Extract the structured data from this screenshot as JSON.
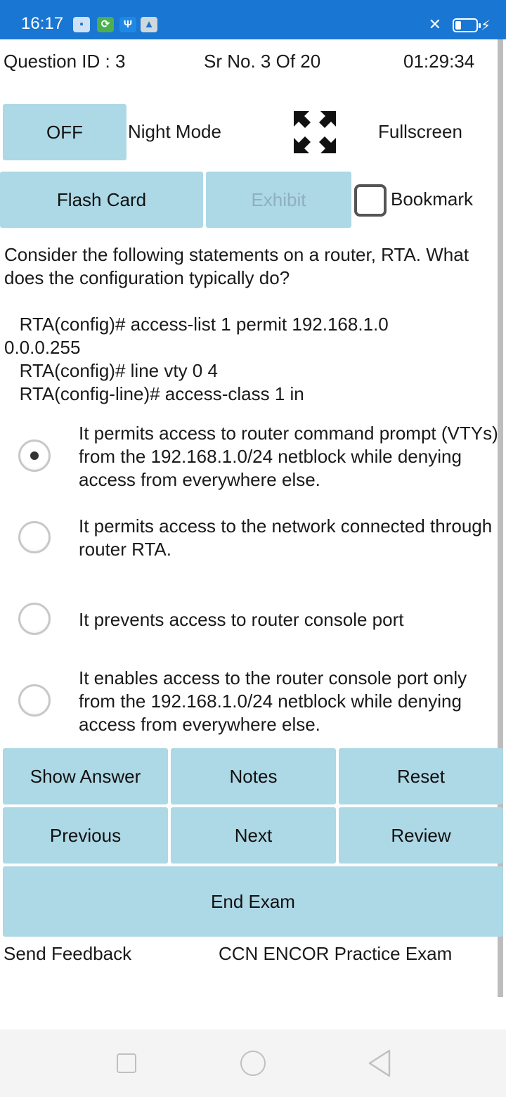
{
  "status_bar": {
    "time": "16:17",
    "icons": [
      "image-icon",
      "app-icon",
      "usb-icon",
      "ai-icon"
    ],
    "right_icons": [
      "vibrate-off-icon",
      "battery-icon",
      "charging-icon"
    ],
    "color": "#1976d2"
  },
  "header": {
    "question_id": "Question ID : 3",
    "serial": "Sr No. 3 Of 20",
    "timer": "01:29:34"
  },
  "controls": {
    "night_toggle": "OFF",
    "night_label": "Night Mode",
    "fullscreen_label": "Fullscreen",
    "flash_card": "Flash Card",
    "exhibit": "Exhibit",
    "bookmark_label": "Bookmark"
  },
  "question": {
    "text": "Consider the following statements on a router, RTA. What does the configuration typically do?",
    "code_lines": [
      "   RTA(config)# access-list 1 permit 192.168.1.0",
      "0.0.0.255",
      "   RTA(config)# line vty 0 4",
      "   RTA(config-line)# access-class 1 in"
    ]
  },
  "options": [
    {
      "text": "It permits access to router command prompt (VTYs) from the 192.168.1.0/24 netblock while denying access from everywhere else.",
      "selected": true
    },
    {
      "text": "It permits access to the network connected through router RTA.",
      "selected": false
    },
    {
      "text": "It prevents access to router console port",
      "selected": false
    },
    {
      "text": "It enables access to the router console port only from the 192.168.1.0/24 netblock while denying access from everywhere else.",
      "selected": false
    }
  ],
  "actions": {
    "show_answer": "Show Answer",
    "notes": "Notes",
    "reset": "Reset",
    "previous": "Previous",
    "next": "Next",
    "review": "Review",
    "end_exam": "End Exam"
  },
  "footer": {
    "feedback": "Send Feedback",
    "title": "CCN ENCOR Practice Exam"
  },
  "colors": {
    "button_bg": "#add8e6",
    "disabled_text": "#8fb0bd"
  }
}
